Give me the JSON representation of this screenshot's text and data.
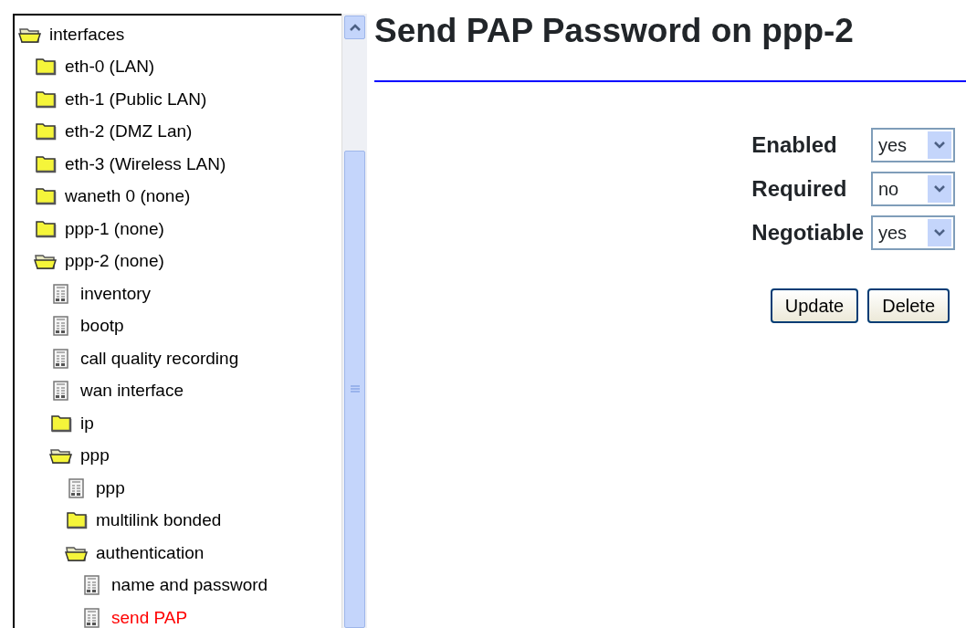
{
  "tree": [
    {
      "label": "interfaces",
      "kind": "folder",
      "expanded": true,
      "selected": false,
      "children": [
        {
          "label": "eth-0 (LAN)",
          "kind": "folder",
          "expanded": false,
          "selected": false
        },
        {
          "label": "eth-1 (Public LAN)",
          "kind": "folder",
          "expanded": false,
          "selected": false
        },
        {
          "label": "eth-2 (DMZ Lan)",
          "kind": "folder",
          "expanded": false,
          "selected": false
        },
        {
          "label": "eth-3 (Wireless LAN)",
          "kind": "folder",
          "expanded": false,
          "selected": false
        },
        {
          "label": "waneth 0 (none)",
          "kind": "folder",
          "expanded": false,
          "selected": false
        },
        {
          "label": "ppp-1 (none)",
          "kind": "folder",
          "expanded": false,
          "selected": false
        },
        {
          "label": "ppp-2 (none)",
          "kind": "folder",
          "expanded": true,
          "selected": false,
          "children": [
            {
              "label": "inventory",
              "kind": "page",
              "selected": false
            },
            {
              "label": "bootp",
              "kind": "page",
              "selected": false
            },
            {
              "label": "call quality recording",
              "kind": "page",
              "selected": false
            },
            {
              "label": "wan interface",
              "kind": "page",
              "selected": false
            },
            {
              "label": "ip",
              "kind": "folder",
              "expanded": false,
              "selected": false
            },
            {
              "label": "ppp",
              "kind": "folder",
              "expanded": true,
              "selected": false,
              "children": [
                {
                  "label": "ppp",
                  "kind": "page",
                  "selected": false
                },
                {
                  "label": "multilink bonded",
                  "kind": "folder",
                  "expanded": false,
                  "selected": false
                },
                {
                  "label": "authentication",
                  "kind": "folder",
                  "expanded": true,
                  "selected": false,
                  "children": [
                    {
                      "label": "name and password",
                      "kind": "page",
                      "selected": false
                    },
                    {
                      "label": "send PAP",
                      "kind": "page",
                      "selected": true
                    }
                  ]
                }
              ]
            }
          ]
        }
      ]
    }
  ],
  "page": {
    "title": "Send PAP Password on ppp-2",
    "fields": [
      {
        "label": "Enabled",
        "value": "yes"
      },
      {
        "label": "Required",
        "value": "no"
      },
      {
        "label": "Negotiable",
        "value": "yes"
      }
    ],
    "buttons": [
      "Update",
      "Delete"
    ]
  }
}
